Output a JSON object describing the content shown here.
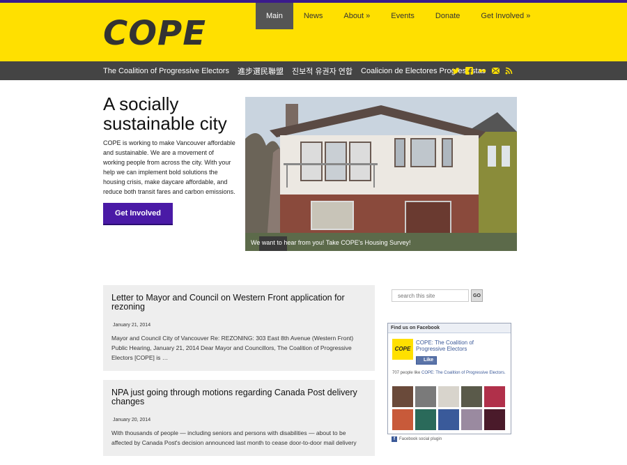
{
  "logo": "COPE",
  "nav": {
    "items": [
      "Main",
      "News",
      "About »",
      "Events",
      "Donate",
      "Get Involved »"
    ]
  },
  "subbar": {
    "links": [
      "The Coalition of Progressive Electors",
      "進步選民聯盟",
      "진보적 유권자 연합",
      "Coalicion de Electores Progressistas"
    ],
    "social_icons": [
      "twitter-icon",
      "facebook-icon",
      "flickr-icon",
      "email-icon",
      "rss-icon"
    ],
    "accent": "#ffe000"
  },
  "hero": {
    "title": "A socially sustainable city",
    "body": "COPE is working to make Vancouver affordable and sustainable. We are a movement of working people from across the city. With your help we can implement bold solutions the housing crisis, make daycare affordable, and reduce both transit fares and carbon emissions.",
    "cta_label": "Get Involved",
    "cta_color": "#4a1aa6",
    "photo_caption": "We want to hear from you! Take COPE's Housing Survey!"
  },
  "posts": [
    {
      "title": "Letter to Mayor and Council on Western Front application for rezoning",
      "date": "January 21, 2014",
      "excerpt": "Mayor and Council City of Vancouver Re: REZONING: 303 East 8th Avenue (Western Front) Public Hearing, January 21, 2014 Dear Mayor and Councillors, The Coalition of Progressive Electors [COPE] is …"
    },
    {
      "title": "NPA just going through motions regarding Canada Post delivery changes",
      "date": "January 20, 2014",
      "excerpt": "With thousands of people — including seniors and persons with disabilities — about to be affected by Canada Post's decision announced last month to cease door-to-door mail delivery"
    }
  ],
  "search": {
    "placeholder": "search this site",
    "button_label": "GO"
  },
  "facebook": {
    "header": "Find us on Facebook",
    "page_logo": "COPE",
    "page_name": "COPE: The Coalition of Progressive Electors",
    "like_label": "Like",
    "count_prefix": "707 people like ",
    "count_page": "COPE: The Coalition of Progressive Electors.",
    "plugin_label": "Facebook social plugin"
  }
}
